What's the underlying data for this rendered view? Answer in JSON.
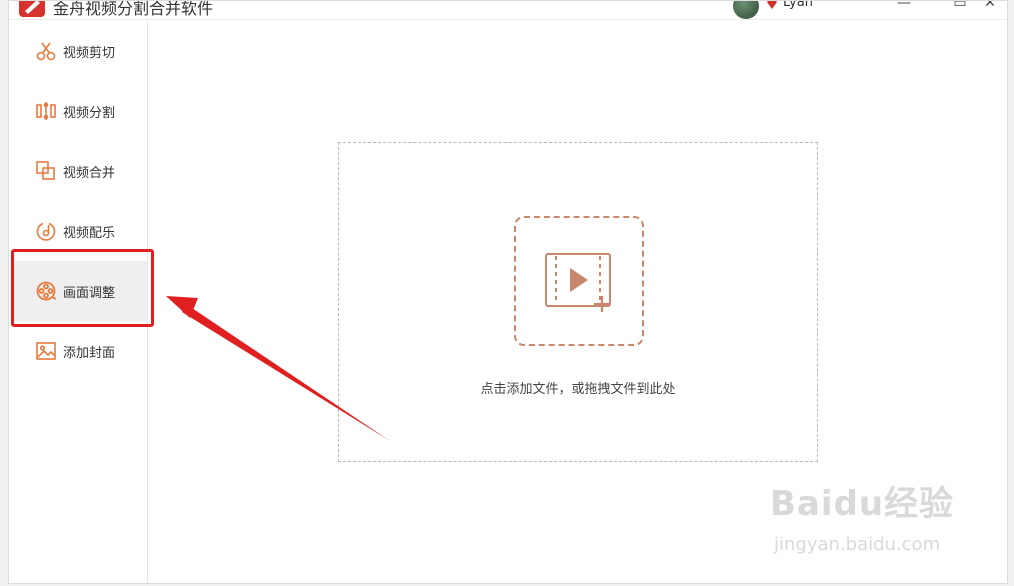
{
  "app": {
    "title": "金舟视频分割合并软件"
  },
  "user": {
    "name": "Lyan"
  },
  "window_controls": {
    "minimize": "—",
    "maximize": "▭",
    "close": "✕"
  },
  "sidebar": {
    "items": [
      {
        "label": "视频剪切",
        "icon": "scissors-icon",
        "active": false
      },
      {
        "label": "视频分割",
        "icon": "split-icon",
        "active": false
      },
      {
        "label": "视频合并",
        "icon": "merge-icon",
        "active": false
      },
      {
        "label": "视频配乐",
        "icon": "music-disc-icon",
        "active": false
      },
      {
        "label": "画面调整",
        "icon": "film-reel-icon",
        "active": true
      },
      {
        "label": "添加封面",
        "icon": "image-icon",
        "active": false
      }
    ]
  },
  "main": {
    "drop_hint": "点击添加文件，或拖拽文件到此处",
    "add_icon": "add-video-icon"
  },
  "colors": {
    "accent": "#e87a3c",
    "highlight": "#e02020",
    "tile_border": "#c9876e"
  },
  "watermark": {
    "brand": "Baidu经验",
    "url": "jingyan.baidu.com"
  }
}
